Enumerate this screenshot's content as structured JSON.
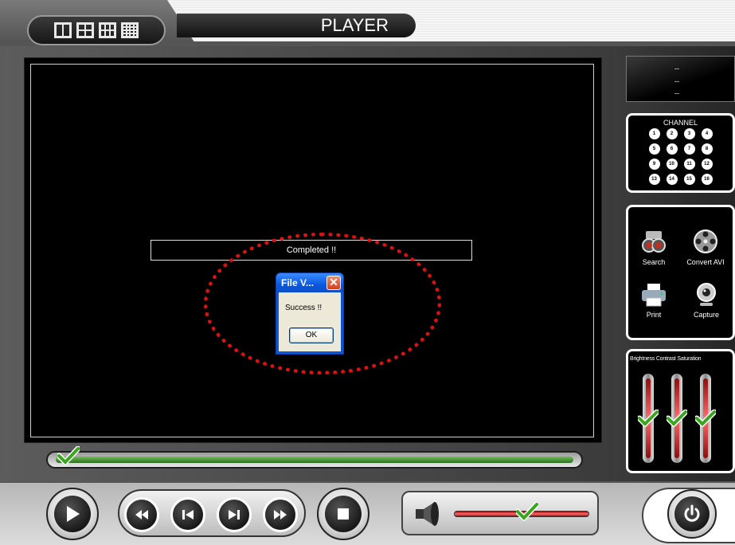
{
  "top": {
    "title": "PLAYER",
    "layouts": [
      "split-2",
      "split-4",
      "split-6",
      "split-16"
    ]
  },
  "video": {
    "progress_message": "Completed !!"
  },
  "dialog": {
    "title": "File V...",
    "close_glyph": "✕",
    "message": "Success !!",
    "ok_label": "OK"
  },
  "info": {
    "line1": "--",
    "line2": "--",
    "line3": "--"
  },
  "channel": {
    "title": "CHANNEL",
    "numbers": [
      "1",
      "2",
      "3",
      "4",
      "5",
      "6",
      "7",
      "8",
      "9",
      "10",
      "11",
      "12",
      "13",
      "14",
      "15",
      "16"
    ]
  },
  "tools": {
    "search_label": "Search",
    "convert_label": "Convert AVI",
    "print_label": "Print",
    "capture_label": "Capture"
  },
  "adjust": {
    "title": "Brightness Contrast Saturation",
    "brightness_level": 0.5,
    "contrast_level": 0.5,
    "saturation_level": 0.5
  },
  "playback": {
    "position_fraction": 0.0
  },
  "volume": {
    "level": 0.55
  },
  "colors": {
    "accent_green": "#3aa61f",
    "alert_red": "#e01010",
    "xp_blue": "#0b55d8"
  }
}
